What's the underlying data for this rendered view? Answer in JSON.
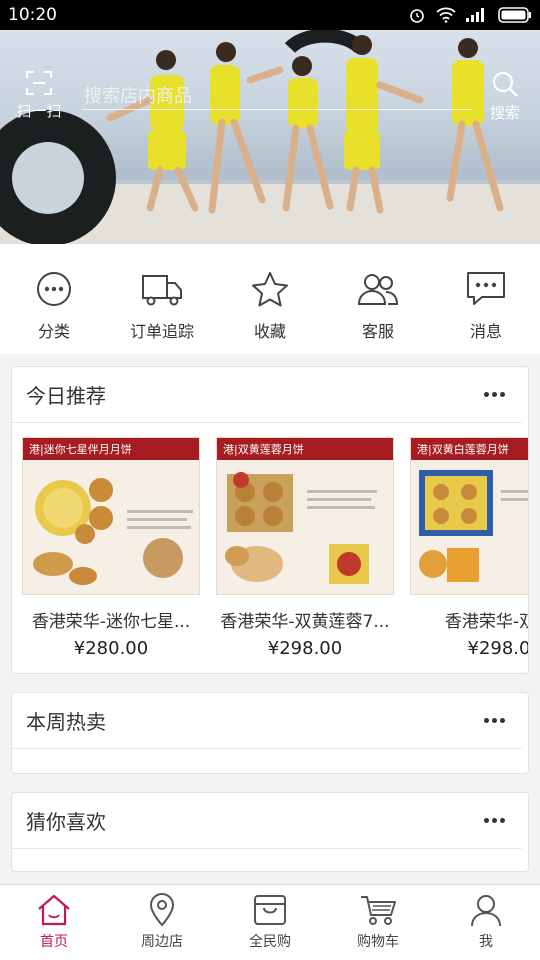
{
  "status_bar": {
    "time": "10:20"
  },
  "header": {
    "scan_label": "扫一扫",
    "search_placeholder": "搜索店内商品",
    "search_label": "搜索"
  },
  "quick_nav": [
    {
      "label": "分类",
      "icon": "more-circle-icon"
    },
    {
      "label": "订单追踪",
      "icon": "truck-icon"
    },
    {
      "label": "收藏",
      "icon": "star-icon"
    },
    {
      "label": "客服",
      "icon": "users-icon"
    },
    {
      "label": "消息",
      "icon": "message-icon"
    }
  ],
  "sections": {
    "today": {
      "title": "今日推荐",
      "products": [
        {
          "name": "香港荣华-迷你七星...",
          "price": "¥280.00",
          "banner": "港|迷你七星伴月月饼"
        },
        {
          "name": "香港荣华-双黄莲蓉7...",
          "price": "¥298.00",
          "banner": "港|双黄莲蓉月饼"
        },
        {
          "name": "香港荣华-双黄",
          "price": "¥298.0",
          "banner": "港|双黄白莲蓉月饼"
        }
      ]
    },
    "weekly": {
      "title": "本周热卖"
    },
    "guess": {
      "title": "猜你喜欢"
    }
  },
  "tabbar": [
    {
      "label": "首页",
      "icon": "home-icon",
      "active": true
    },
    {
      "label": "周边店",
      "icon": "location-pin-icon",
      "active": false
    },
    {
      "label": "全民购",
      "icon": "shopping-bag-icon",
      "active": false
    },
    {
      "label": "购物车",
      "icon": "cart-icon",
      "active": false
    },
    {
      "label": "我",
      "icon": "user-icon",
      "active": false
    }
  ],
  "colors": {
    "accent": "#c2185b",
    "banner_yellow": "#e8e02a"
  }
}
